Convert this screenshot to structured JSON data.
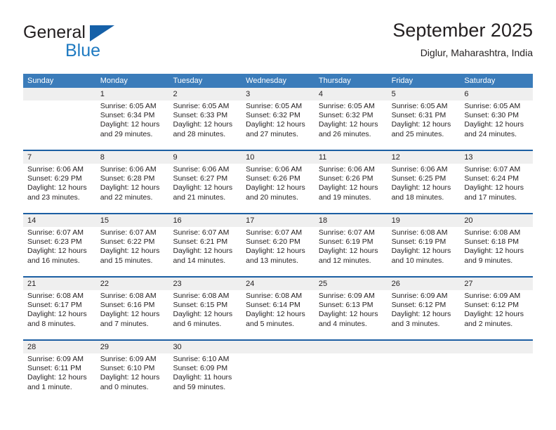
{
  "brand": {
    "name_top": "General",
    "name_bottom": "Blue",
    "triangle_color": "#1560a8",
    "blue_color": "#1f7ac1"
  },
  "header": {
    "title": "September 2025",
    "subtitle": "Diglur, Maharashtra, India"
  },
  "theme": {
    "header_row_bg": "#3b7cba",
    "week_separator": "#1c5fa3",
    "daynum_band_bg": "#efefef",
    "text": "#231f20"
  },
  "weekday_headers": [
    "Sunday",
    "Monday",
    "Tuesday",
    "Wednesday",
    "Thursday",
    "Friday",
    "Saturday"
  ],
  "weeks": [
    [
      {
        "day": "",
        "lines": []
      },
      {
        "day": "1",
        "lines": [
          "Sunrise: 6:05 AM",
          "Sunset: 6:34 PM",
          "Daylight: 12 hours",
          "and 29 minutes."
        ]
      },
      {
        "day": "2",
        "lines": [
          "Sunrise: 6:05 AM",
          "Sunset: 6:33 PM",
          "Daylight: 12 hours",
          "and 28 minutes."
        ]
      },
      {
        "day": "3",
        "lines": [
          "Sunrise: 6:05 AM",
          "Sunset: 6:32 PM",
          "Daylight: 12 hours",
          "and 27 minutes."
        ]
      },
      {
        "day": "4",
        "lines": [
          "Sunrise: 6:05 AM",
          "Sunset: 6:32 PM",
          "Daylight: 12 hours",
          "and 26 minutes."
        ]
      },
      {
        "day": "5",
        "lines": [
          "Sunrise: 6:05 AM",
          "Sunset: 6:31 PM",
          "Daylight: 12 hours",
          "and 25 minutes."
        ]
      },
      {
        "day": "6",
        "lines": [
          "Sunrise: 6:05 AM",
          "Sunset: 6:30 PM",
          "Daylight: 12 hours",
          "and 24 minutes."
        ]
      }
    ],
    [
      {
        "day": "7",
        "lines": [
          "Sunrise: 6:06 AM",
          "Sunset: 6:29 PM",
          "Daylight: 12 hours",
          "and 23 minutes."
        ]
      },
      {
        "day": "8",
        "lines": [
          "Sunrise: 6:06 AM",
          "Sunset: 6:28 PM",
          "Daylight: 12 hours",
          "and 22 minutes."
        ]
      },
      {
        "day": "9",
        "lines": [
          "Sunrise: 6:06 AM",
          "Sunset: 6:27 PM",
          "Daylight: 12 hours",
          "and 21 minutes."
        ]
      },
      {
        "day": "10",
        "lines": [
          "Sunrise: 6:06 AM",
          "Sunset: 6:26 PM",
          "Daylight: 12 hours",
          "and 20 minutes."
        ]
      },
      {
        "day": "11",
        "lines": [
          "Sunrise: 6:06 AM",
          "Sunset: 6:26 PM",
          "Daylight: 12 hours",
          "and 19 minutes."
        ]
      },
      {
        "day": "12",
        "lines": [
          "Sunrise: 6:06 AM",
          "Sunset: 6:25 PM",
          "Daylight: 12 hours",
          "and 18 minutes."
        ]
      },
      {
        "day": "13",
        "lines": [
          "Sunrise: 6:07 AM",
          "Sunset: 6:24 PM",
          "Daylight: 12 hours",
          "and 17 minutes."
        ]
      }
    ],
    [
      {
        "day": "14",
        "lines": [
          "Sunrise: 6:07 AM",
          "Sunset: 6:23 PM",
          "Daylight: 12 hours",
          "and 16 minutes."
        ]
      },
      {
        "day": "15",
        "lines": [
          "Sunrise: 6:07 AM",
          "Sunset: 6:22 PM",
          "Daylight: 12 hours",
          "and 15 minutes."
        ]
      },
      {
        "day": "16",
        "lines": [
          "Sunrise: 6:07 AM",
          "Sunset: 6:21 PM",
          "Daylight: 12 hours",
          "and 14 minutes."
        ]
      },
      {
        "day": "17",
        "lines": [
          "Sunrise: 6:07 AM",
          "Sunset: 6:20 PM",
          "Daylight: 12 hours",
          "and 13 minutes."
        ]
      },
      {
        "day": "18",
        "lines": [
          "Sunrise: 6:07 AM",
          "Sunset: 6:19 PM",
          "Daylight: 12 hours",
          "and 12 minutes."
        ]
      },
      {
        "day": "19",
        "lines": [
          "Sunrise: 6:08 AM",
          "Sunset: 6:19 PM",
          "Daylight: 12 hours",
          "and 10 minutes."
        ]
      },
      {
        "day": "20",
        "lines": [
          "Sunrise: 6:08 AM",
          "Sunset: 6:18 PM",
          "Daylight: 12 hours",
          "and 9 minutes."
        ]
      }
    ],
    [
      {
        "day": "21",
        "lines": [
          "Sunrise: 6:08 AM",
          "Sunset: 6:17 PM",
          "Daylight: 12 hours",
          "and 8 minutes."
        ]
      },
      {
        "day": "22",
        "lines": [
          "Sunrise: 6:08 AM",
          "Sunset: 6:16 PM",
          "Daylight: 12 hours",
          "and 7 minutes."
        ]
      },
      {
        "day": "23",
        "lines": [
          "Sunrise: 6:08 AM",
          "Sunset: 6:15 PM",
          "Daylight: 12 hours",
          "and 6 minutes."
        ]
      },
      {
        "day": "24",
        "lines": [
          "Sunrise: 6:08 AM",
          "Sunset: 6:14 PM",
          "Daylight: 12 hours",
          "and 5 minutes."
        ]
      },
      {
        "day": "25",
        "lines": [
          "Sunrise: 6:09 AM",
          "Sunset: 6:13 PM",
          "Daylight: 12 hours",
          "and 4 minutes."
        ]
      },
      {
        "day": "26",
        "lines": [
          "Sunrise: 6:09 AM",
          "Sunset: 6:12 PM",
          "Daylight: 12 hours",
          "and 3 minutes."
        ]
      },
      {
        "day": "27",
        "lines": [
          "Sunrise: 6:09 AM",
          "Sunset: 6:12 PM",
          "Daylight: 12 hours",
          "and 2 minutes."
        ]
      }
    ],
    [
      {
        "day": "28",
        "lines": [
          "Sunrise: 6:09 AM",
          "Sunset: 6:11 PM",
          "Daylight: 12 hours",
          "and 1 minute."
        ]
      },
      {
        "day": "29",
        "lines": [
          "Sunrise: 6:09 AM",
          "Sunset: 6:10 PM",
          "Daylight: 12 hours",
          "and 0 minutes."
        ]
      },
      {
        "day": "30",
        "lines": [
          "Sunrise: 6:10 AM",
          "Sunset: 6:09 PM",
          "Daylight: 11 hours",
          "and 59 minutes."
        ]
      },
      {
        "day": "",
        "lines": []
      },
      {
        "day": "",
        "lines": []
      },
      {
        "day": "",
        "lines": []
      },
      {
        "day": "",
        "lines": []
      }
    ]
  ]
}
